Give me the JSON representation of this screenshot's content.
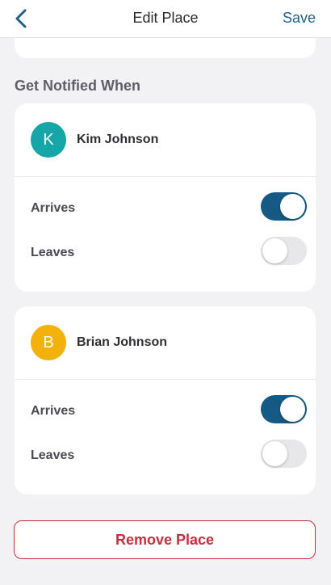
{
  "colors": {
    "accent": "#1f5f8b",
    "toggle_on": "#145a84",
    "toggle_off": "#e7e7ea",
    "danger": "#c92c3b",
    "avatar_kim": "#16a6a8",
    "avatar_brian": "#f2b10b"
  },
  "nav": {
    "back_icon": "chevron-left-icon",
    "title": "Edit Place",
    "save_label": "Save"
  },
  "section": {
    "heading": "Get Notified When"
  },
  "people": [
    {
      "initial": "K",
      "name": "Kim Johnson",
      "settings": [
        {
          "label": "Arrives",
          "enabled": true
        },
        {
          "label": "Leaves",
          "enabled": false
        }
      ]
    },
    {
      "initial": "B",
      "name": "Brian Johnson",
      "settings": [
        {
          "label": "Arrives",
          "enabled": true
        },
        {
          "label": "Leaves",
          "enabled": false
        }
      ]
    }
  ],
  "actions": {
    "remove_label": "Remove Place"
  }
}
